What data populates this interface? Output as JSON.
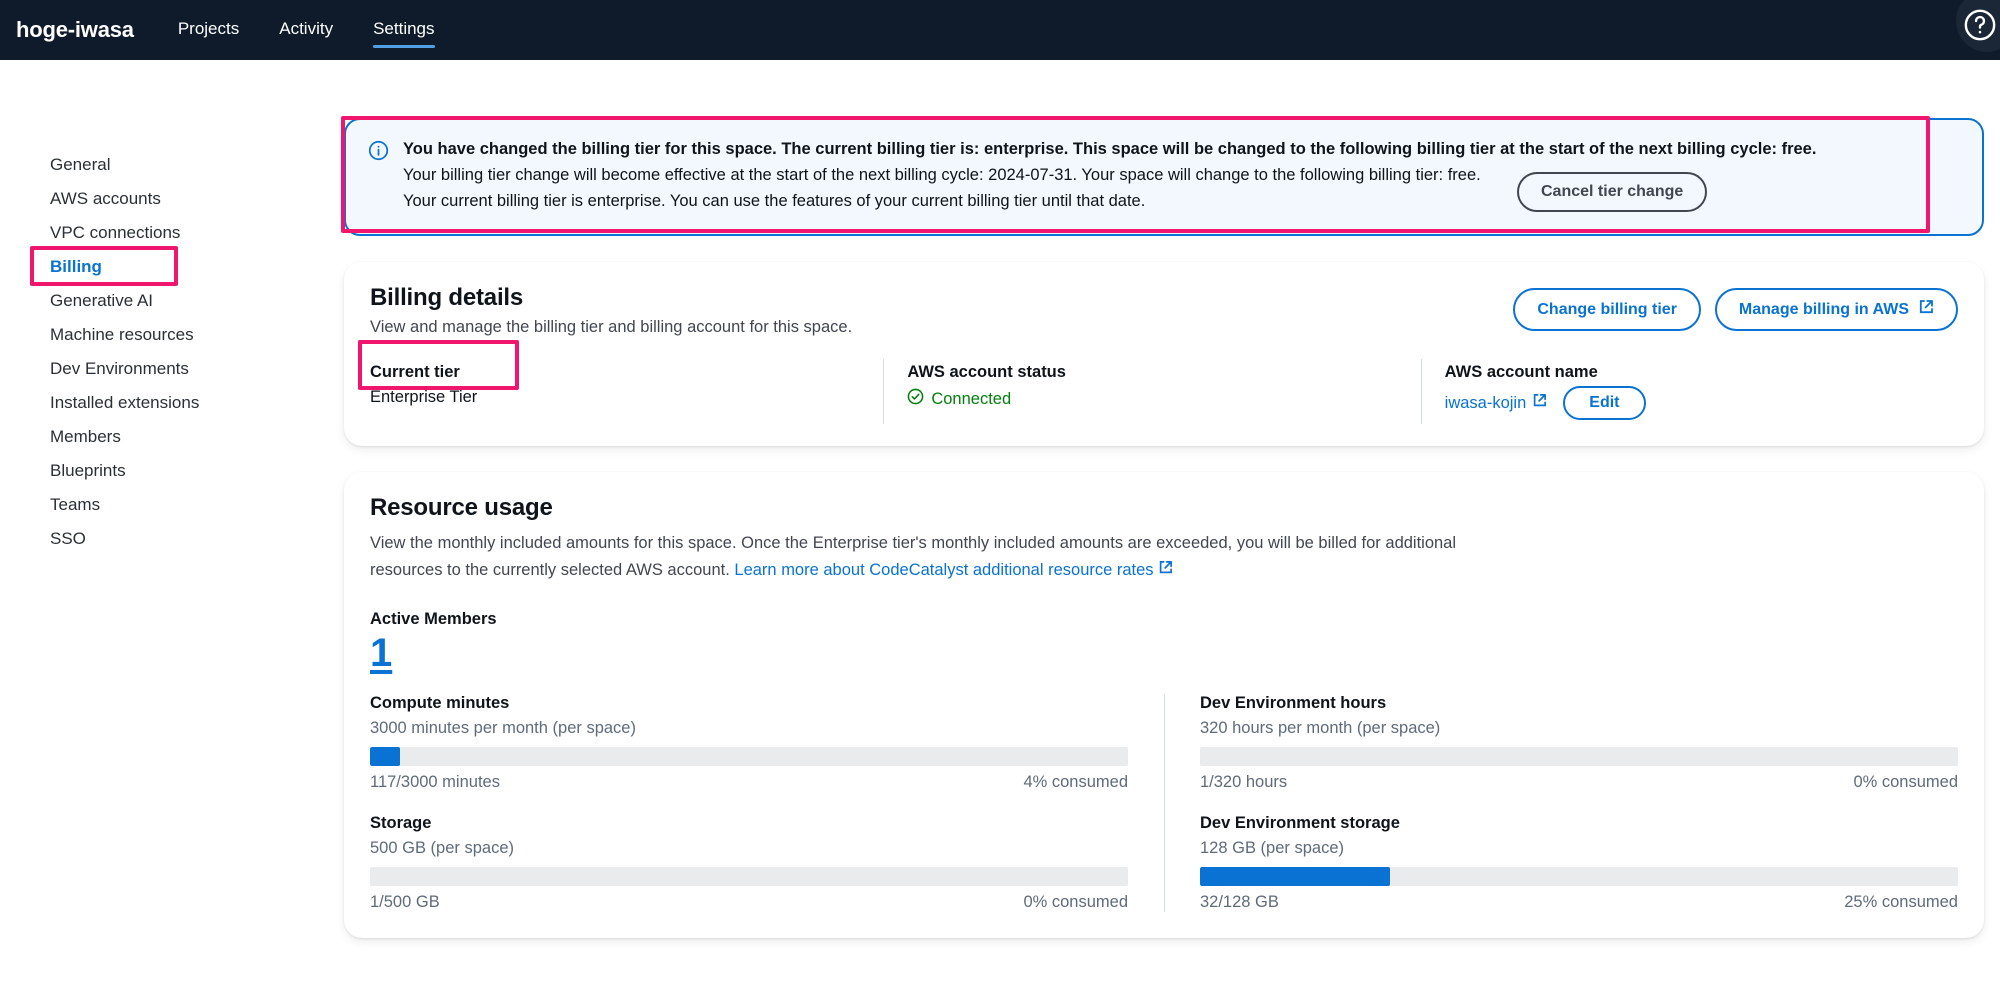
{
  "topnav": {
    "brand": "hoge-iwasa",
    "links": [
      {
        "label": "Projects",
        "active": false
      },
      {
        "label": "Activity",
        "active": false
      },
      {
        "label": "Settings",
        "active": true
      }
    ],
    "help_icon": "help-circle-icon"
  },
  "sidebar": {
    "items": [
      {
        "label": "General",
        "active": false
      },
      {
        "label": "AWS accounts",
        "active": false
      },
      {
        "label": "VPC connections",
        "active": false
      },
      {
        "label": "Billing",
        "active": true
      },
      {
        "label": "Generative AI",
        "active": false
      },
      {
        "label": "Machine resources",
        "active": false
      },
      {
        "label": "Dev Environments",
        "active": false
      },
      {
        "label": "Installed extensions",
        "active": false
      },
      {
        "label": "Members",
        "active": false
      },
      {
        "label": "Blueprints",
        "active": false
      },
      {
        "label": "Teams",
        "active": false
      },
      {
        "label": "SSO",
        "active": false
      }
    ]
  },
  "banner": {
    "icon": "info-icon",
    "headline": "You have changed the billing tier for this space. The current billing tier is: enterprise. This space will be changed to the following billing tier at the start of the next billing cycle: free.",
    "body": "Your billing tier change will become effective at the start of the next billing cycle: 2024-07-31. Your space will change to the following billing tier: free. Your current billing tier is enterprise. You can use the features of your current billing tier until that date.",
    "cancel_label": "Cancel tier change"
  },
  "billing_details": {
    "title": "Billing details",
    "description": "View and manage the billing tier and billing account for this space.",
    "change_tier_label": "Change billing tier",
    "manage_billing_label": "Manage billing in AWS",
    "current_tier_label": "Current tier",
    "current_tier_value": "Enterprise Tier",
    "account_status_label": "AWS account status",
    "account_status_value": "Connected",
    "account_name_label": "AWS account name",
    "account_name_value": "iwasa-kojin",
    "edit_label": "Edit"
  },
  "resource_usage": {
    "title": "Resource usage",
    "description_part1": "View the monthly included amounts for this space. Once the Enterprise tier's monthly included amounts are exceeded, you will be billed for additional resources to the currently selected AWS account. ",
    "link_label": "Learn more about CodeCatalyst additional resource rates",
    "active_members_label": "Active Members",
    "active_members_value": "1",
    "metrics_left": [
      {
        "name": "Compute minutes",
        "allowance": "3000 minutes per month (per space)",
        "used_text": "117/3000 minutes",
        "consumed_text": "4% consumed",
        "percent": 4
      },
      {
        "name": "Storage",
        "allowance": "500 GB (per space)",
        "used_text": "1/500 GB",
        "consumed_text": "0% consumed",
        "percent": 0
      }
    ],
    "metrics_right": [
      {
        "name": "Dev Environment hours",
        "allowance": "320 hours per month (per space)",
        "used_text": "1/320 hours",
        "consumed_text": "0% consumed",
        "percent": 0
      },
      {
        "name": "Dev Environment storage",
        "allowance": "128 GB (per space)",
        "used_text": "32/128 GB",
        "consumed_text": "25% consumed",
        "percent": 25
      }
    ]
  },
  "colors": {
    "nav_background": "#0f1b2a",
    "accent_blue": "#0972d3",
    "banner_background": "#f2f8fd",
    "success_green": "#037f0c",
    "annotation_pink": "#f0166d",
    "bar_track": "#e9ebed"
  }
}
